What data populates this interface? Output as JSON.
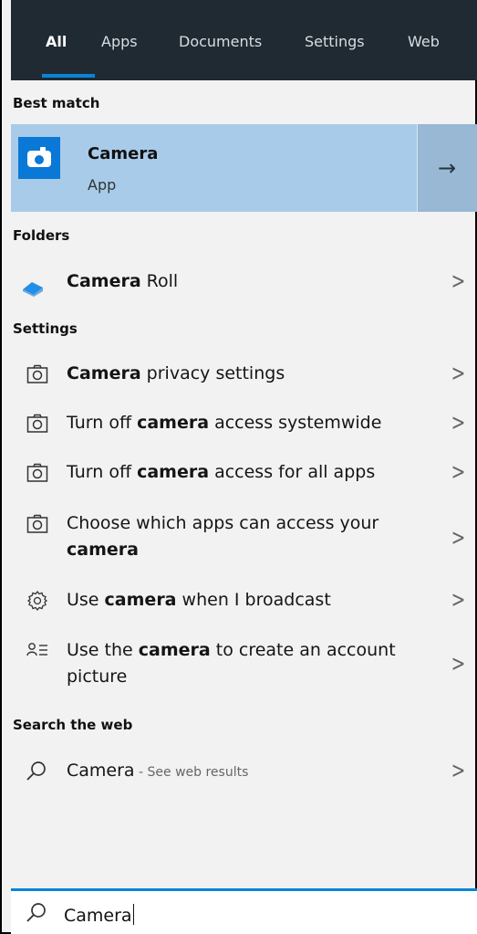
{
  "tabs": [
    {
      "label": "All",
      "active": true
    },
    {
      "label": "Apps"
    },
    {
      "label": "Documents"
    },
    {
      "label": "Settings"
    },
    {
      "label": "Web"
    }
  ],
  "sections": {
    "best_match": "Best match",
    "folders": "Folders",
    "settings": "Settings",
    "search_web": "Search the web"
  },
  "best_match": {
    "title": "Camera",
    "subtitle": "App",
    "icon": "camera-app-icon",
    "arrow_icon": "right-arrow-icon"
  },
  "folders": [
    {
      "bold": "Camera",
      "rest": " Roll",
      "icon": "folder-cloud-icon"
    }
  ],
  "settings": [
    {
      "before": "",
      "bold": "Camera",
      "after": " privacy settings",
      "icon": "camera-outline-icon"
    },
    {
      "before": "Turn off ",
      "bold": "camera",
      "after": " access systemwide",
      "icon": "camera-outline-icon"
    },
    {
      "before": "Turn off ",
      "bold": "camera",
      "after": " access for all apps",
      "icon": "camera-outline-icon"
    },
    {
      "before": "Choose which apps can access your ",
      "bold": "camera",
      "after": "",
      "icon": "camera-outline-icon"
    },
    {
      "before": "Use ",
      "bold": "camera",
      "after": " when I broadcast",
      "icon": "gear-icon"
    },
    {
      "before": "Use the ",
      "bold": "camera",
      "after": " to create an account picture",
      "icon": "account-list-icon"
    }
  ],
  "web": {
    "query": "Camera",
    "suffix": " - See web results",
    "icon": "search-icon"
  },
  "search": {
    "value": "Camera",
    "icon": "search-icon"
  },
  "colors": {
    "tab_bar": "#1f2a33",
    "accent": "#0a84d8",
    "best_match_bg": "#a8cbe9"
  }
}
